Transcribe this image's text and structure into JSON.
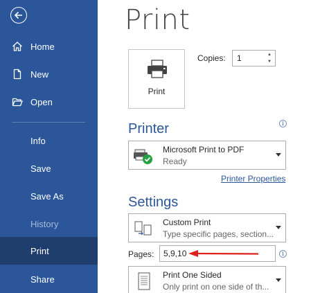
{
  "sidebar": {
    "back_icon": "back-arrow-icon",
    "items": [
      {
        "label": "Home",
        "icon": "home-icon"
      },
      {
        "label": "New",
        "icon": "new-document-icon"
      },
      {
        "label": "Open",
        "icon": "open-folder-icon"
      },
      {
        "label": "Info"
      },
      {
        "label": "Save"
      },
      {
        "label": "Save As"
      },
      {
        "label": "History",
        "state": "disabled"
      },
      {
        "label": "Print",
        "state": "active"
      },
      {
        "label": "Share"
      }
    ]
  },
  "main": {
    "title": "Print",
    "print_button": {
      "label": "Print",
      "icon": "printer-icon"
    },
    "copies": {
      "label": "Copies:",
      "value": "1"
    },
    "printer": {
      "section_title": "Printer",
      "name": "Microsoft Print to PDF",
      "status": "Ready",
      "icon": "printer-ready-icon",
      "properties_link": "Printer Properties"
    },
    "settings": {
      "section_title": "Settings",
      "range": {
        "main": "Custom Print",
        "sub": "Type specific pages, section..."
      },
      "pages": {
        "label": "Pages:",
        "value": "5,9,10"
      },
      "sides": {
        "main": "Print One Sided",
        "sub": "Only print on one side of th..."
      }
    }
  },
  "colors": {
    "sidebar_bg": "#2b579a",
    "sidebar_active": "#1f3e6e",
    "accent": "#2b579a",
    "annotation_arrow": "#e0201b"
  }
}
